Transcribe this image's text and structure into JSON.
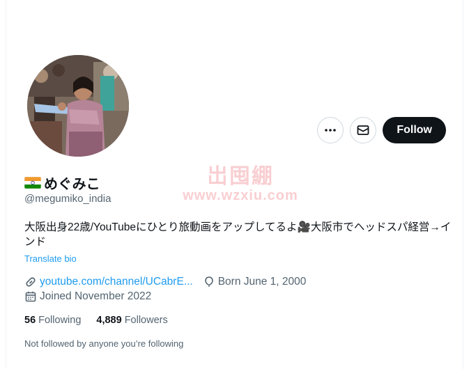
{
  "profile": {
    "flag_icon": "india-flag-icon",
    "display_name": "めぐみこ",
    "handle": "@megumiko_india",
    "bio": "大阪出身22歳/YouTubeにひとり旅動画をアップしてるよ🎥大阪市でヘッドスパ経営→インド",
    "translate_label": "Translate bio",
    "link_text": "youtube.com/channel/UCabrE...",
    "born_text": "Born June 1, 2000",
    "joined_text": "Joined November 2022",
    "following_count": "56",
    "following_label": "Following",
    "followers_count": "4,889",
    "followers_label": "Followers",
    "not_followed_text": "Not followed by anyone you’re following"
  },
  "actions": {
    "more_icon": "more-horizontal-icon",
    "message_icon": "envelope-icon",
    "follow_label": "Follow"
  },
  "watermark": {
    "logo_text": "岀囤綳",
    "url_text": "www.wzxiu.com"
  },
  "colors": {
    "accent": "#1d9bf0",
    "primary_text": "#0f1419",
    "secondary_text": "#536471",
    "follow_bg": "#0f1419"
  }
}
